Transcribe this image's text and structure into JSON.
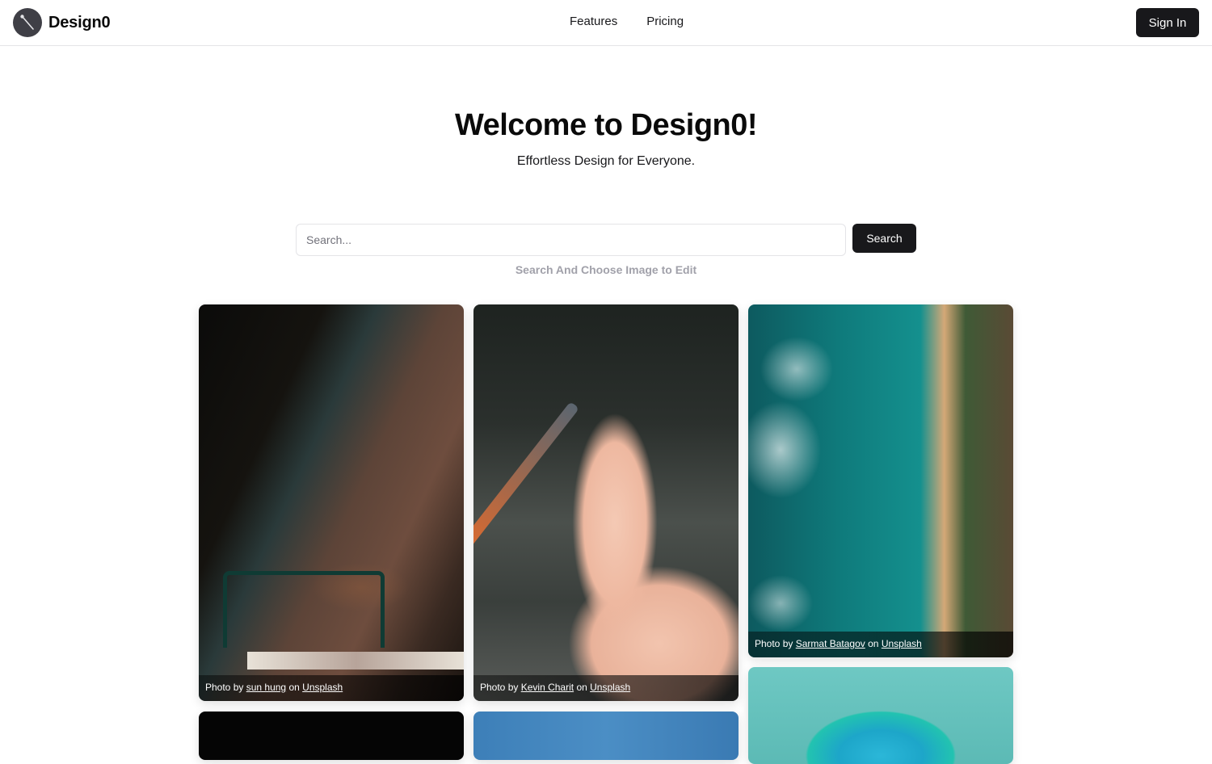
{
  "header": {
    "brand": "Design0",
    "logo_icon": "pen-tool-icon",
    "nav": [
      {
        "label": "Features"
      },
      {
        "label": "Pricing"
      }
    ],
    "signin_label": "Sign In"
  },
  "hero": {
    "title": "Welcome to Design0!",
    "subtitle": "Effortless Design for Everyone."
  },
  "search": {
    "placeholder": "Search...",
    "value": "",
    "button_label": "Search",
    "hint": "Search And Choose Image to Edit"
  },
  "gallery": {
    "caption_prefix": "Photo by",
    "caption_mid": "on",
    "source": "Unsplash",
    "items": [
      {
        "subject": "playground with swings",
        "author": "sun hung"
      },
      {
        "subject": "pink pelican",
        "author": "Kevin Charit"
      },
      {
        "subject": "aerial coastline",
        "author": "Sarmat Batagov"
      },
      {
        "subject": "teal abstract sculpture",
        "author": ""
      },
      {
        "subject": "dark photo",
        "author": ""
      },
      {
        "subject": "blue sky",
        "author": ""
      }
    ]
  }
}
